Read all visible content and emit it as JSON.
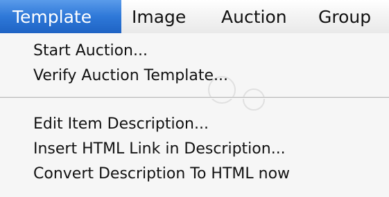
{
  "menubar": {
    "items": [
      {
        "label": "Template",
        "active": true
      },
      {
        "label": "Image",
        "active": false
      },
      {
        "label": "Auction",
        "active": false
      },
      {
        "label": "Group",
        "active": false
      }
    ]
  },
  "dropdown": {
    "group1": [
      {
        "label": "Start Auction..."
      },
      {
        "label": "Verify Auction Template..."
      }
    ],
    "group2": [
      {
        "label": "Edit Item Description..."
      },
      {
        "label": "Insert HTML Link in Description..."
      },
      {
        "label": "Convert Description To HTML now"
      }
    ]
  },
  "colors": {
    "highlight": "#2e78d8",
    "menu_background": "#f6f6f6",
    "text": "#111111",
    "highlight_text": "#ffffff"
  }
}
